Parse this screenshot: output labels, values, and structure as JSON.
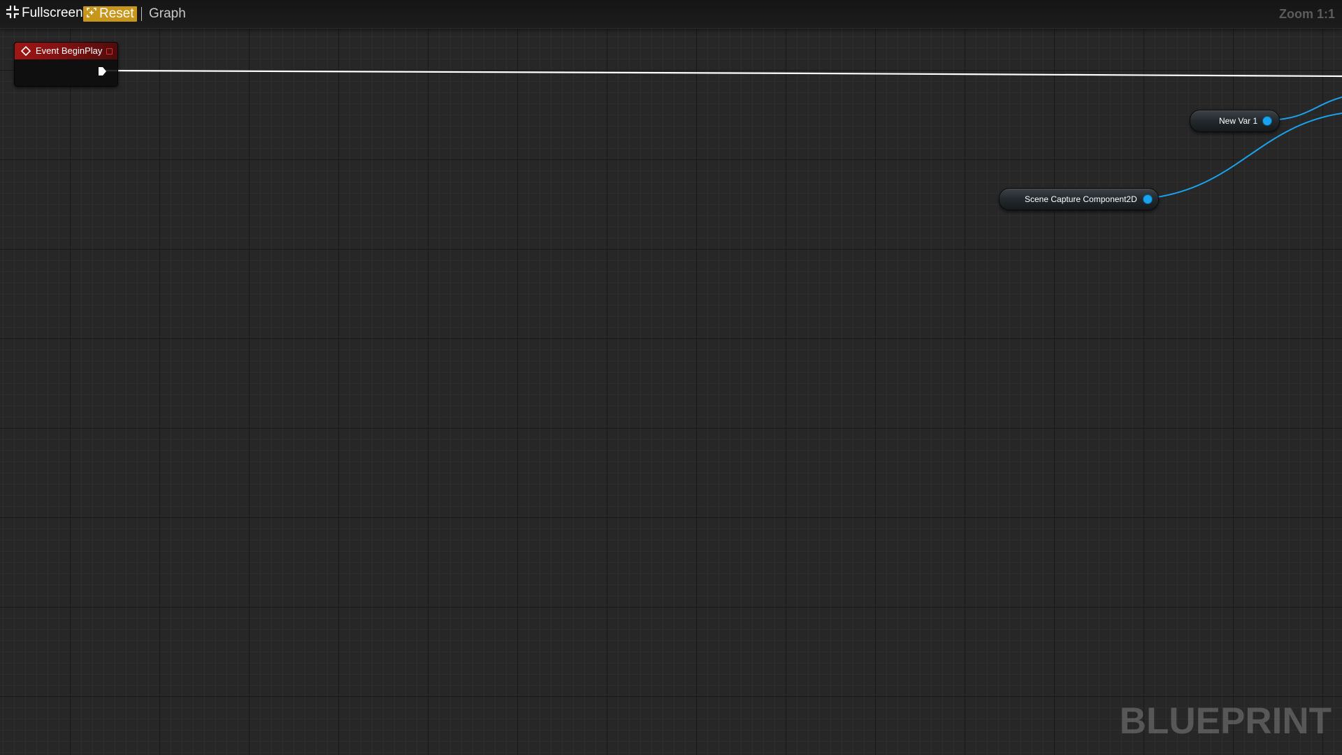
{
  "toolbar": {
    "fullscreen_label": "Fullscreen",
    "reset_label": "Reset",
    "graph_label": "Graph",
    "zoom_label": "Zoom 1:1",
    "reset_color": "#c8961a"
  },
  "nodes": {
    "event_begin_play": {
      "title": "Event BeginPlay",
      "header_color": "#a01616",
      "icon": "event-diamond-icon"
    },
    "new_var": {
      "label": "New Var 1",
      "pin_color": "#19a3ef"
    },
    "scene_capture": {
      "label": "Scene Capture Component2D",
      "pin_color": "#19a3ef"
    }
  },
  "wires": {
    "exec_color": "#ffffff",
    "object_color": "#19a3ef"
  },
  "watermark": "BLUEPRINT"
}
